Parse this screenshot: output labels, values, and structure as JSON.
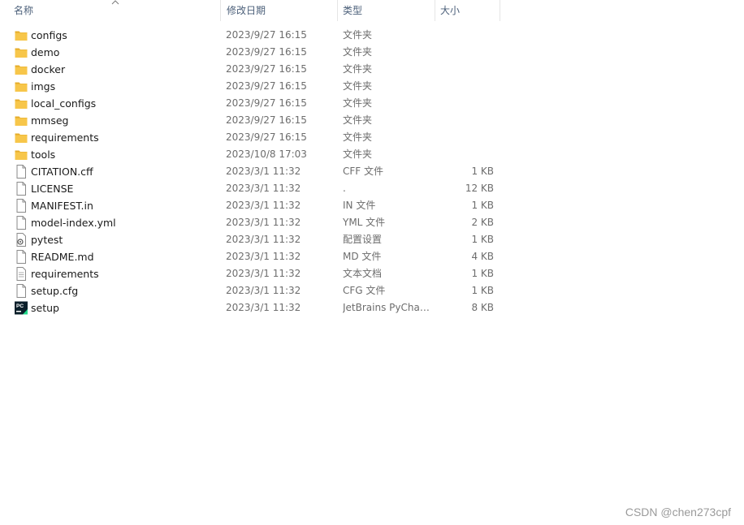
{
  "columns": {
    "name": "名称",
    "date": "修改日期",
    "type": "类型",
    "size": "大小"
  },
  "files": [
    {
      "name": "configs",
      "date": "2023/9/27 16:15",
      "type": "文件夹",
      "size": "",
      "icon": "folder-icon"
    },
    {
      "name": "demo",
      "date": "2023/9/27 16:15",
      "type": "文件夹",
      "size": "",
      "icon": "folder-icon"
    },
    {
      "name": "docker",
      "date": "2023/9/27 16:15",
      "type": "文件夹",
      "size": "",
      "icon": "folder-icon"
    },
    {
      "name": "imgs",
      "date": "2023/9/27 16:15",
      "type": "文件夹",
      "size": "",
      "icon": "folder-icon"
    },
    {
      "name": "local_configs",
      "date": "2023/9/27 16:15",
      "type": "文件夹",
      "size": "",
      "icon": "folder-icon"
    },
    {
      "name": "mmseg",
      "date": "2023/9/27 16:15",
      "type": "文件夹",
      "size": "",
      "icon": "folder-icon"
    },
    {
      "name": "requirements",
      "date": "2023/9/27 16:15",
      "type": "文件夹",
      "size": "",
      "icon": "folder-icon"
    },
    {
      "name": "tools",
      "date": "2023/10/8 17:03",
      "type": "文件夹",
      "size": "",
      "icon": "folder-icon"
    },
    {
      "name": "CITATION.cff",
      "date": "2023/3/1 11:32",
      "type": "CFF 文件",
      "size": "1 KB",
      "icon": "file-icon"
    },
    {
      "name": "LICENSE",
      "date": "2023/3/1 11:32",
      "type": ".",
      "size": "12 KB",
      "icon": "file-icon"
    },
    {
      "name": "MANIFEST.in",
      "date": "2023/3/1 11:32",
      "type": "IN 文件",
      "size": "1 KB",
      "icon": "file-icon"
    },
    {
      "name": "model-index.yml",
      "date": "2023/3/1 11:32",
      "type": "YML 文件",
      "size": "2 KB",
      "icon": "file-icon"
    },
    {
      "name": "pytest",
      "date": "2023/3/1 11:32",
      "type": "配置设置",
      "size": "1 KB",
      "icon": "settings-file-icon"
    },
    {
      "name": "README.md",
      "date": "2023/3/1 11:32",
      "type": "MD 文件",
      "size": "4 KB",
      "icon": "file-icon"
    },
    {
      "name": "requirements",
      "date": "2023/3/1 11:32",
      "type": "文本文档",
      "size": "1 KB",
      "icon": "text-file-icon"
    },
    {
      "name": "setup.cfg",
      "date": "2023/3/1 11:32",
      "type": "CFG 文件",
      "size": "1 KB",
      "icon": "file-icon"
    },
    {
      "name": "setup",
      "date": "2023/3/1 11:32",
      "type": "JetBrains PyChar...",
      "size": "8 KB",
      "icon": "pycharm-icon"
    }
  ],
  "colors": {
    "folder": "#f7c64a",
    "folder_dark": "#e6ac2a",
    "header_text": "#4c607a",
    "pycharm_bg": "#0b1f2a",
    "pycharm_green": "#21d789"
  },
  "watermark": "CSDN @chen273cpf"
}
